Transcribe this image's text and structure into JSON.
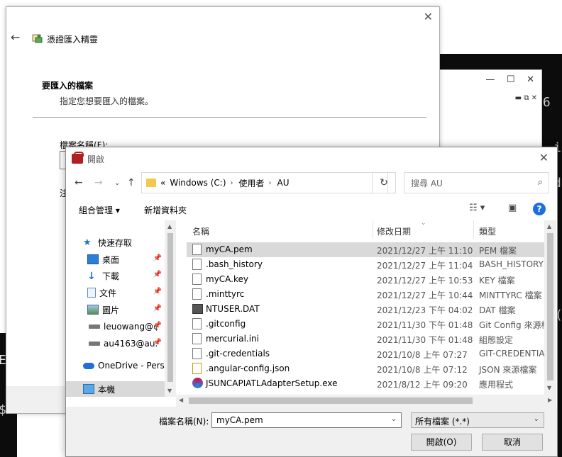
{
  "wizard": {
    "title": "憑證匯入精靈",
    "heading": "要匯入的檔案",
    "subheading": "指定您想要匯入的檔案。",
    "filename_label": "檔案名稱(F):",
    "note_label": "注"
  },
  "dialog": {
    "title": "開啟",
    "breadcrumb": [
      "Windows (C:)",
      "使用者",
      "AU"
    ],
    "breadcrumb_prefix": "«",
    "search_placeholder": "搜尋 AU",
    "toolbar": {
      "organize": "組合管理",
      "new_folder": "新增資料夾"
    },
    "nav": [
      {
        "label": "快速存取",
        "icon": "star-icon",
        "pinned": false
      },
      {
        "label": "桌面",
        "icon": "desktop-icon",
        "pinned": true
      },
      {
        "label": "下載",
        "icon": "download-icon",
        "pinned": true
      },
      {
        "label": "文件",
        "icon": "document-icon",
        "pinned": true
      },
      {
        "label": "圖片",
        "icon": "pictures-icon",
        "pinned": true
      },
      {
        "label": "leuowang@¢",
        "icon": "drive-icon",
        "pinned": true
      },
      {
        "label": "au4163@au.",
        "icon": "drive-icon",
        "pinned": true
      },
      {
        "label": "OneDrive - Perso",
        "icon": "onedrive-icon",
        "pinned": false
      },
      {
        "label": "本機",
        "icon": "computer-icon",
        "pinned": false
      }
    ],
    "columns": {
      "name": "名稱",
      "date": "修改日期",
      "type": "類型"
    },
    "files": [
      {
        "name": "myCA.pem",
        "date": "2021/12/27 上午 11:10",
        "type": "PEM 檔案"
      },
      {
        "name": ".bash_history",
        "date": "2021/12/27 上午 11:04",
        "type": "BASH_HISTORY"
      },
      {
        "name": "myCA.key",
        "date": "2021/12/27 上午 10:53",
        "type": "KEY 檔案"
      },
      {
        "name": ".minttyrc",
        "date": "2021/12/27 上午 10:44",
        "type": "MINTTYRC 檔案"
      },
      {
        "name": "NTUSER.DAT",
        "date": "2021/12/23 下午 04:02",
        "type": "DAT 檔案"
      },
      {
        "name": ".gitconfig",
        "date": "2021/11/30 下午 01:48",
        "type": "Git Config 來源檔"
      },
      {
        "name": "mercurial.ini",
        "date": "2021/11/30 下午 01:48",
        "type": "組態設定"
      },
      {
        "name": ".git-credentials",
        "date": "2021/10/8 上午 07:27",
        "type": "GIT-CREDENTIA"
      },
      {
        "name": ".angular-config.json",
        "date": "2021/10/8 上午 07:12",
        "type": "JSON 來源檔案"
      },
      {
        "name": "JSUNCAPIATLAdapterSetup.exe",
        "date": "2021/8/12 上午 09:20",
        "type": "應用程式"
      }
    ],
    "filename_label": "檔案名稱(N):",
    "filename_value": "myCA.pem",
    "filter_value": "所有檔案 (*.*)",
    "open_label": "開啟(O)",
    "cancel_label": "取消"
  },
  "background": {
    "term_chars": [
      "56",
      "i",
      "d",
      "(",
      "E",
      "$"
    ]
  }
}
